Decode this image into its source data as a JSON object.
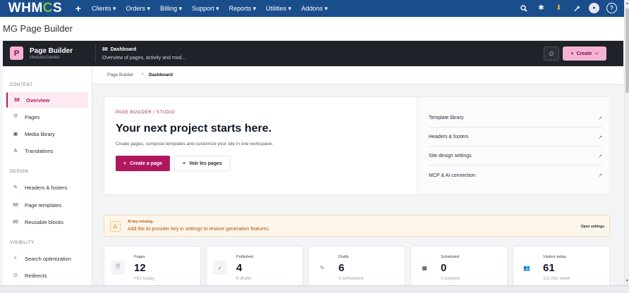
{
  "topnav": {
    "logo_text_a": "WHM",
    "logo_text_b": "C",
    "logo_text_c": "S",
    "plus": "+",
    "menu": [
      "Clients ▾",
      "Orders ▾",
      "Billing ▾",
      "Support ▾",
      "Reports ▾",
      "Utilities ▾",
      "Addons ▾"
    ]
  },
  "page_title": "MG Page Builder",
  "mg_header": {
    "brand_letter": "P",
    "brand_name": "Page Builder",
    "brand_sub": "ModulesGarden",
    "section_icon": "88",
    "section_title": "Dashboard",
    "section_sub": "Overview of pages, activity and mod...",
    "link_icon": "∅",
    "create_label": "Create",
    "create_plus": "+",
    "create_chevron": "⌵"
  },
  "sidebar": {
    "sections": [
      {
        "label": "CONTENT",
        "items": [
          {
            "label": "Overview",
            "icon": "88",
            "active": true
          },
          {
            "label": "Pages",
            "icon": "🗎"
          },
          {
            "label": "Media library",
            "icon": "▣"
          },
          {
            "label": "Translations",
            "icon": "A"
          }
        ]
      },
      {
        "label": "DESIGN",
        "items": [
          {
            "label": "Headers & footers",
            "icon": "✎"
          },
          {
            "label": "Page templates",
            "icon": "88"
          },
          {
            "label": "Reusable blocks",
            "icon": "88"
          }
        ]
      },
      {
        "label": "VISIBILITY",
        "items": [
          {
            "label": "Search optimization",
            "icon": "⌕"
          },
          {
            "label": "Redirects",
            "icon": "∅"
          }
        ]
      }
    ]
  },
  "breadcrumb": {
    "parent": "Page Builder",
    "sep": ">",
    "current": "Dashboard"
  },
  "hero": {
    "eyebrow": "PAGE BUILDER / STUDIO",
    "title": "Your next project starts here.",
    "desc": "Create pages, compose templates and customize your site in one workspace.",
    "primary_plus": "+",
    "primary_label": "Create a page",
    "secondary_icon": "≡",
    "secondary_label": "Voir les pages",
    "quick_links": [
      {
        "label": "Template library",
        "arrow": "↗"
      },
      {
        "label": "Headers & footers",
        "arrow": "↗"
      },
      {
        "label": "Site design settings",
        "arrow": "↗"
      },
      {
        "label": "MCP & AI connection",
        "arrow": "↗"
      }
    ]
  },
  "alert": {
    "icon": "⚠",
    "title": "AI key missing.",
    "text": "Add the AI provider key in settings to restore generation features.",
    "link": "Open settings"
  },
  "stats": [
    {
      "label": "Pages",
      "value": "12",
      "sub": "+61 today",
      "icon": "🗎"
    },
    {
      "label": "Published",
      "value": "4",
      "sub": "6 drafts",
      "icon": "✓"
    },
    {
      "label": "Drafts",
      "value": "6",
      "sub": "0 scheduled",
      "icon": "✎"
    },
    {
      "label": "Scheduled",
      "value": "0",
      "sub": "0 expired",
      "icon": "▦"
    },
    {
      "label": "Visitors today",
      "value": "61",
      "sub": "111 this week",
      "icon": "👥"
    }
  ],
  "colors": {
    "nav": "#1a4d8c",
    "accent": "#b0185e",
    "pink": "#f6b2d4",
    "dark_header": "#1f2228"
  }
}
